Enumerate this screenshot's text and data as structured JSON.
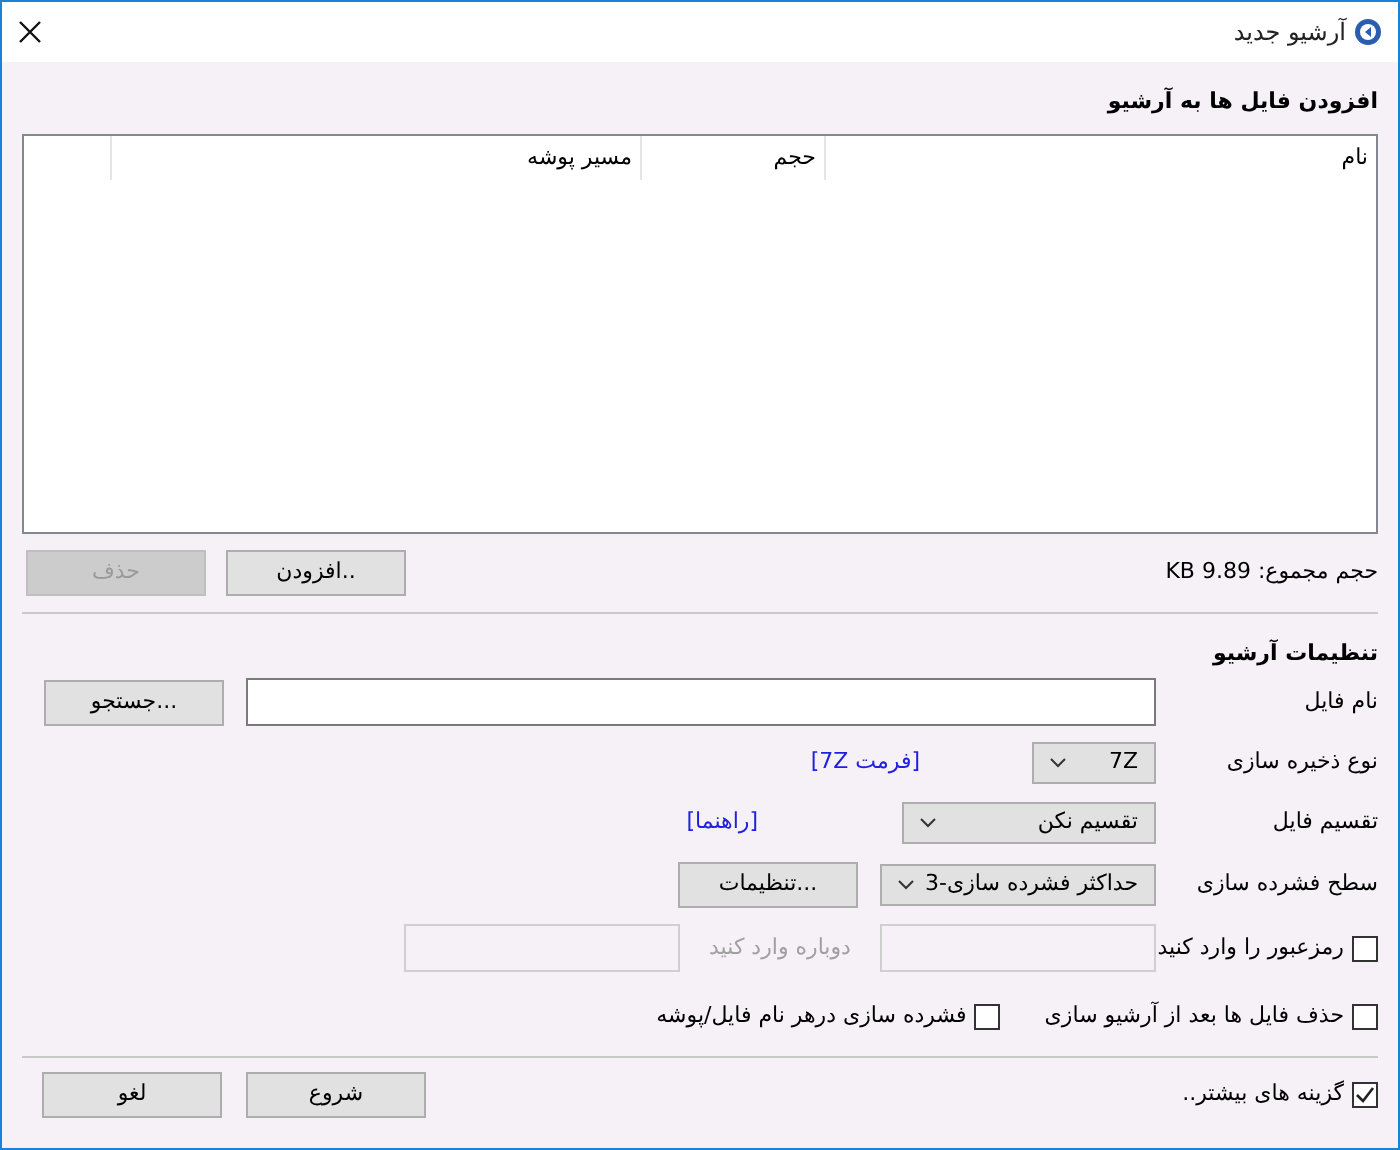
{
  "window": {
    "title": "آرشیو جدید"
  },
  "files_section": {
    "heading": "افزودن فایل ها به آرشیو",
    "columns": [
      "نام",
      "حجم",
      "مسیر پوشه"
    ],
    "total": "حجم مجموع: KB 9.89",
    "buttons": [
      {
        "label": "افزودن..",
        "disabled": false
      },
      {
        "label": "حذف",
        "disabled": true
      }
    ]
  },
  "settings": {
    "heading": "تنظیمات آرشیو",
    "file_name": {
      "label": "نام فایل",
      "browse": "جستجو..."
    },
    "storage_type": {
      "label": "نوع ذخیره سازی",
      "value": "7Z",
      "link": "[فرمت 7Z]"
    },
    "split": {
      "label": "تقسیم فایل",
      "value": "تقسیم نکن",
      "link": "[راهنما]"
    },
    "compression": {
      "label": "سطح فشرده سازی",
      "value": "حداکثر فشرده سازی-3",
      "button": "تنظیمات..."
    },
    "password": {
      "label": "رمزعبور را وارد کنید",
      "checked": false,
      "repeat_label": "دوباره وارد کنید"
    },
    "options": [
      {
        "label": "حذف فایل ها بعد از آرشیو سازی",
        "checked": false
      },
      {
        "label": "فشرده سازی درهر نام فایل/پوشه",
        "checked": false
      }
    ]
  },
  "footer": {
    "more_options": {
      "label": "گزینه های بیشتر..",
      "checked": true
    },
    "buttons": [
      "شروع",
      "لغو"
    ]
  }
}
